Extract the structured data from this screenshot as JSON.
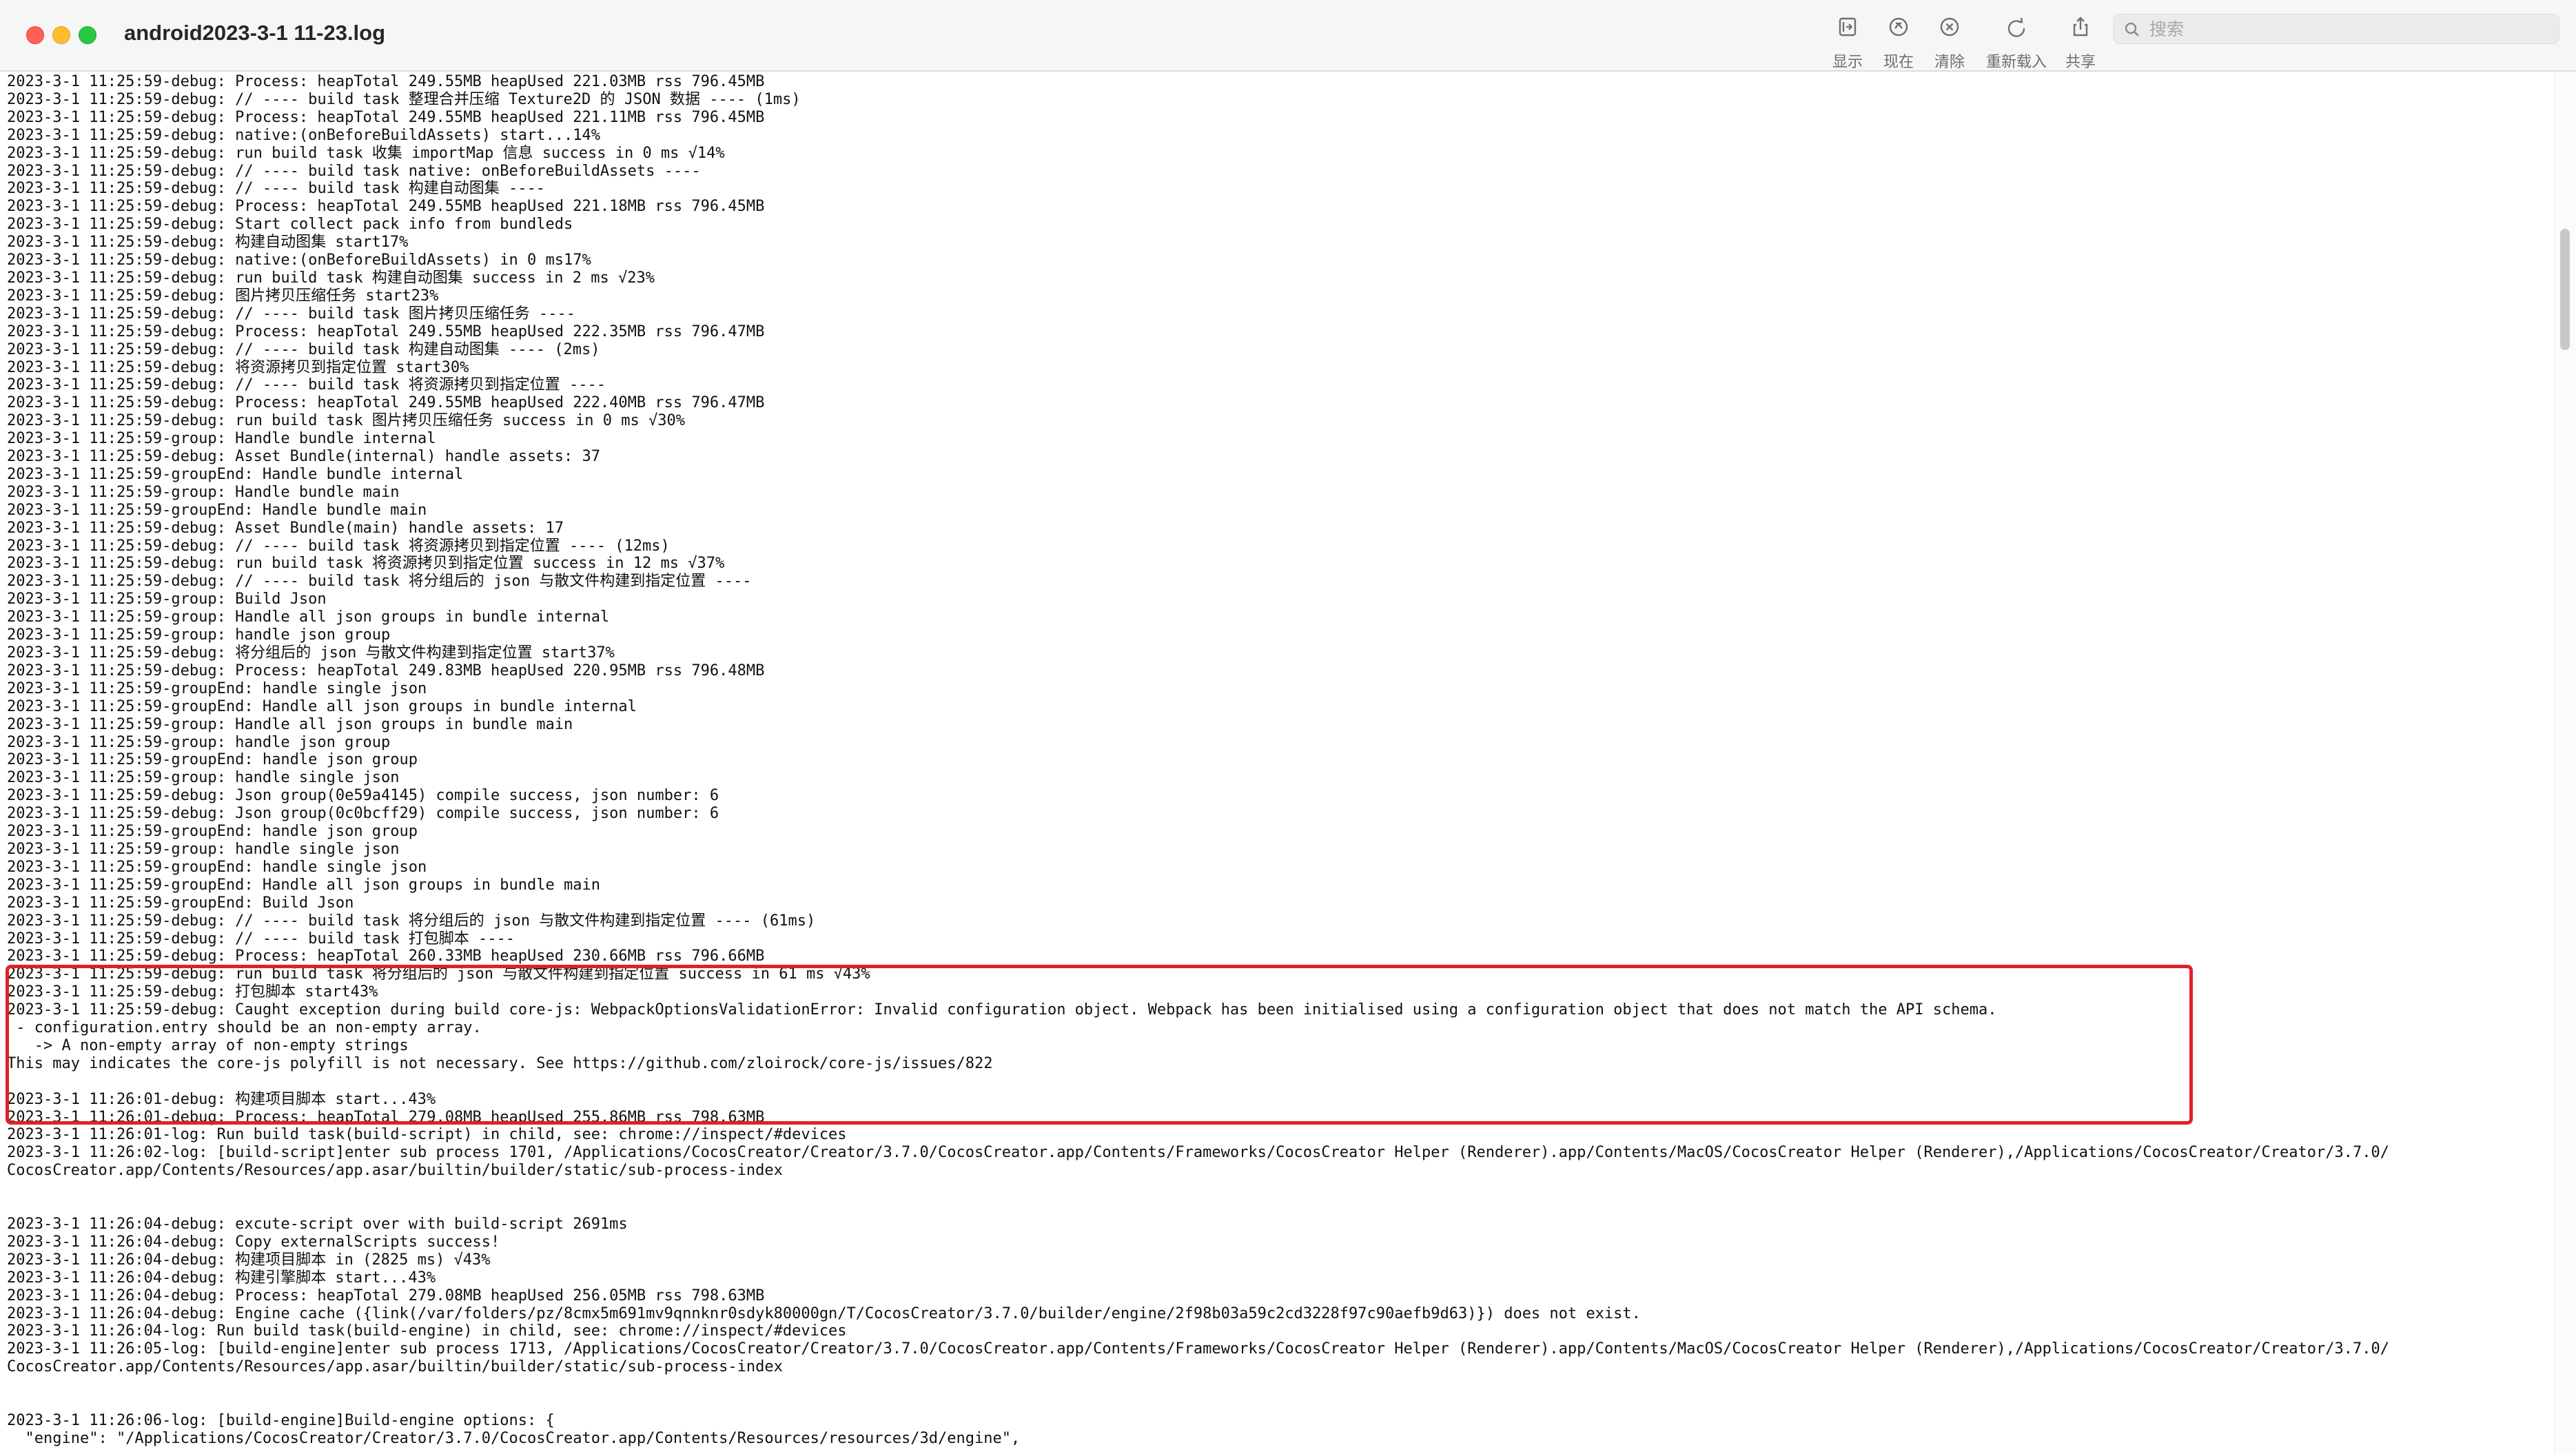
{
  "window": {
    "title": "android2023-3-1 11-23.log"
  },
  "toolbar": {
    "show_label": "显示",
    "now_label": "现在",
    "clear_label": "清除",
    "reload_label": "重新载入",
    "share_label": "共享"
  },
  "search": {
    "placeholder": "搜索",
    "value": ""
  },
  "log": {
    "lines": [
      "2023-3-1 11:25:59-debug: Process: heapTotal 249.55MB heapUsed 221.03MB rss 796.45MB",
      "2023-3-1 11:25:59-debug: // ---- build task 整理合并压缩 Texture2D 的 JSON 数据 ---- (1ms)",
      "2023-3-1 11:25:59-debug: Process: heapTotal 249.55MB heapUsed 221.11MB rss 796.45MB",
      "2023-3-1 11:25:59-debug: native:(onBeforeBuildAssets) start...14%",
      "2023-3-1 11:25:59-debug: run build task 收集 importMap 信息 success in 0 ms √14%",
      "2023-3-1 11:25:59-debug: // ---- build task native: onBeforeBuildAssets ----",
      "2023-3-1 11:25:59-debug: // ---- build task 构建自动图集 ----",
      "2023-3-1 11:25:59-debug: Process: heapTotal 249.55MB heapUsed 221.18MB rss 796.45MB",
      "2023-3-1 11:25:59-debug: Start collect pack info from bundleds",
      "2023-3-1 11:25:59-debug: 构建自动图集 start17%",
      "2023-3-1 11:25:59-debug: native:(onBeforeBuildAssets) in 0 ms17%",
      "2023-3-1 11:25:59-debug: run build task 构建自动图集 success in 2 ms √23%",
      "2023-3-1 11:25:59-debug: 图片拷贝压缩任务 start23%",
      "2023-3-1 11:25:59-debug: // ---- build task 图片拷贝压缩任务 ----",
      "2023-3-1 11:25:59-debug: Process: heapTotal 249.55MB heapUsed 222.35MB rss 796.47MB",
      "2023-3-1 11:25:59-debug: // ---- build task 构建自动图集 ---- (2ms)",
      "2023-3-1 11:25:59-debug: 将资源拷贝到指定位置 start30%",
      "2023-3-1 11:25:59-debug: // ---- build task 将资源拷贝到指定位置 ----",
      "2023-3-1 11:25:59-debug: Process: heapTotal 249.55MB heapUsed 222.40MB rss 796.47MB",
      "2023-3-1 11:25:59-debug: run build task 图片拷贝压缩任务 success in 0 ms √30%",
      "2023-3-1 11:25:59-group: Handle bundle internal",
      "2023-3-1 11:25:59-debug: Asset Bundle(internal) handle assets: 37",
      "2023-3-1 11:25:59-groupEnd: Handle bundle internal",
      "2023-3-1 11:25:59-group: Handle bundle main",
      "2023-3-1 11:25:59-groupEnd: Handle bundle main",
      "2023-3-1 11:25:59-debug: Asset Bundle(main) handle assets: 17",
      "2023-3-1 11:25:59-debug: // ---- build task 将资源拷贝到指定位置 ---- (12ms)",
      "2023-3-1 11:25:59-debug: run build task 将资源拷贝到指定位置 success in 12 ms √37%",
      "2023-3-1 11:25:59-debug: // ---- build task 将分组后的 json 与散文件构建到指定位置 ----",
      "2023-3-1 11:25:59-group: Build Json",
      "2023-3-1 11:25:59-group: Handle all json groups in bundle internal",
      "2023-3-1 11:25:59-group: handle json group",
      "2023-3-1 11:25:59-debug: 将分组后的 json 与散文件构建到指定位置 start37%",
      "2023-3-1 11:25:59-debug: Process: heapTotal 249.83MB heapUsed 220.95MB rss 796.48MB",
      "2023-3-1 11:25:59-groupEnd: handle single json",
      "2023-3-1 11:25:59-groupEnd: Handle all json groups in bundle internal",
      "2023-3-1 11:25:59-group: Handle all json groups in bundle main",
      "2023-3-1 11:25:59-group: handle json group",
      "2023-3-1 11:25:59-groupEnd: handle json group",
      "2023-3-1 11:25:59-group: handle single json",
      "2023-3-1 11:25:59-debug: Json group(0e59a4145) compile success, json number: 6",
      "2023-3-1 11:25:59-debug: Json group(0c0bcff29) compile success, json number: 6",
      "2023-3-1 11:25:59-groupEnd: handle json group",
      "2023-3-1 11:25:59-group: handle single json",
      "2023-3-1 11:25:59-groupEnd: handle single json",
      "2023-3-1 11:25:59-groupEnd: Handle all json groups in bundle main",
      "2023-3-1 11:25:59-groupEnd: Build Json",
      "2023-3-1 11:25:59-debug: // ---- build task 将分组后的 json 与散文件构建到指定位置 ---- (61ms)",
      "2023-3-1 11:25:59-debug: // ---- build task 打包脚本 ----",
      "2023-3-1 11:25:59-debug: Process: heapTotal 260.33MB heapUsed 230.66MB rss 796.66MB",
      "2023-3-1 11:25:59-debug: run build task 将分组后的 json 与散文件构建到指定位置 success in 61 ms √43%",
      "2023-3-1 11:25:59-debug: 打包脚本 start43%",
      "2023-3-1 11:25:59-debug: Caught exception during build core-js: WebpackOptionsValidationError: Invalid configuration object. Webpack has been initialised using a configuration object that does not match the API schema.",
      " - configuration.entry should be an non-empty array.",
      "   -> A non-empty array of non-empty strings",
      "This may indicates the core-js polyfill is not necessary. See https://github.com/zloirock/core-js/issues/822",
      "",
      "2023-3-1 11:26:01-debug: 构建项目脚本 start...43%",
      "2023-3-1 11:26:01-debug: Process: heapTotal 279.08MB heapUsed 255.86MB rss 798.63MB",
      "2023-3-1 11:26:01-log: Run build task(build-script) in child, see: chrome://inspect/#devices",
      "2023-3-1 11:26:02-log: [build-script]enter sub process 1701, /Applications/CocosCreator/Creator/3.7.0/CocosCreator.app/Contents/Frameworks/CocosCreator Helper (Renderer).app/Contents/MacOS/CocosCreator Helper (Renderer),/Applications/CocosCreator/Creator/3.7.0/",
      "CocosCreator.app/Contents/Resources/app.asar/builtin/builder/static/sub-process-index",
      "",
      "",
      "2023-3-1 11:26:04-debug: excute-script over with build-script 2691ms",
      "2023-3-1 11:26:04-debug: Copy externalScripts success!",
      "2023-3-1 11:26:04-debug: 构建项目脚本 in (2825 ms) √43%",
      "2023-3-1 11:26:04-debug: 构建引擎脚本 start...43%",
      "2023-3-1 11:26:04-debug: Process: heapTotal 279.08MB heapUsed 256.05MB rss 798.63MB",
      "2023-3-1 11:26:04-debug: Engine cache ({link(/var/folders/pz/8cmx5m691mv9qnnknr0sdyk80000gn/T/CocosCreator/3.7.0/builder/engine/2f98b03a59c2cd3228f97c90aefb9d63)}) does not exist.",
      "2023-3-1 11:26:04-log: Run build task(build-engine) in child, see: chrome://inspect/#devices",
      "2023-3-1 11:26:05-log: [build-engine]enter sub process 1713, /Applications/CocosCreator/Creator/3.7.0/CocosCreator.app/Contents/Frameworks/CocosCreator Helper (Renderer).app/Contents/MacOS/CocosCreator Helper (Renderer),/Applications/CocosCreator/Creator/3.7.0/",
      "CocosCreator.app/Contents/Resources/app.asar/builtin/builder/static/sub-process-index",
      "",
      "",
      "2023-3-1 11:26:06-log: [build-engine]Build-engine options: {",
      "  \"engine\": \"/Applications/CocosCreator/Creator/3.7.0/CocosCreator.app/Contents/Resources/resources/3d/engine\","
    ]
  },
  "colors": {
    "highlight_border": "#e2202a",
    "titlebar_bg": "#f6f6f6",
    "log_text": "#111111"
  },
  "icons": {
    "show": "sidebar-toggle-icon",
    "now": "arrow-up-circle-icon",
    "clear": "x-circle-icon",
    "reload": "reload-icon",
    "share": "share-icon",
    "search": "search-icon"
  }
}
